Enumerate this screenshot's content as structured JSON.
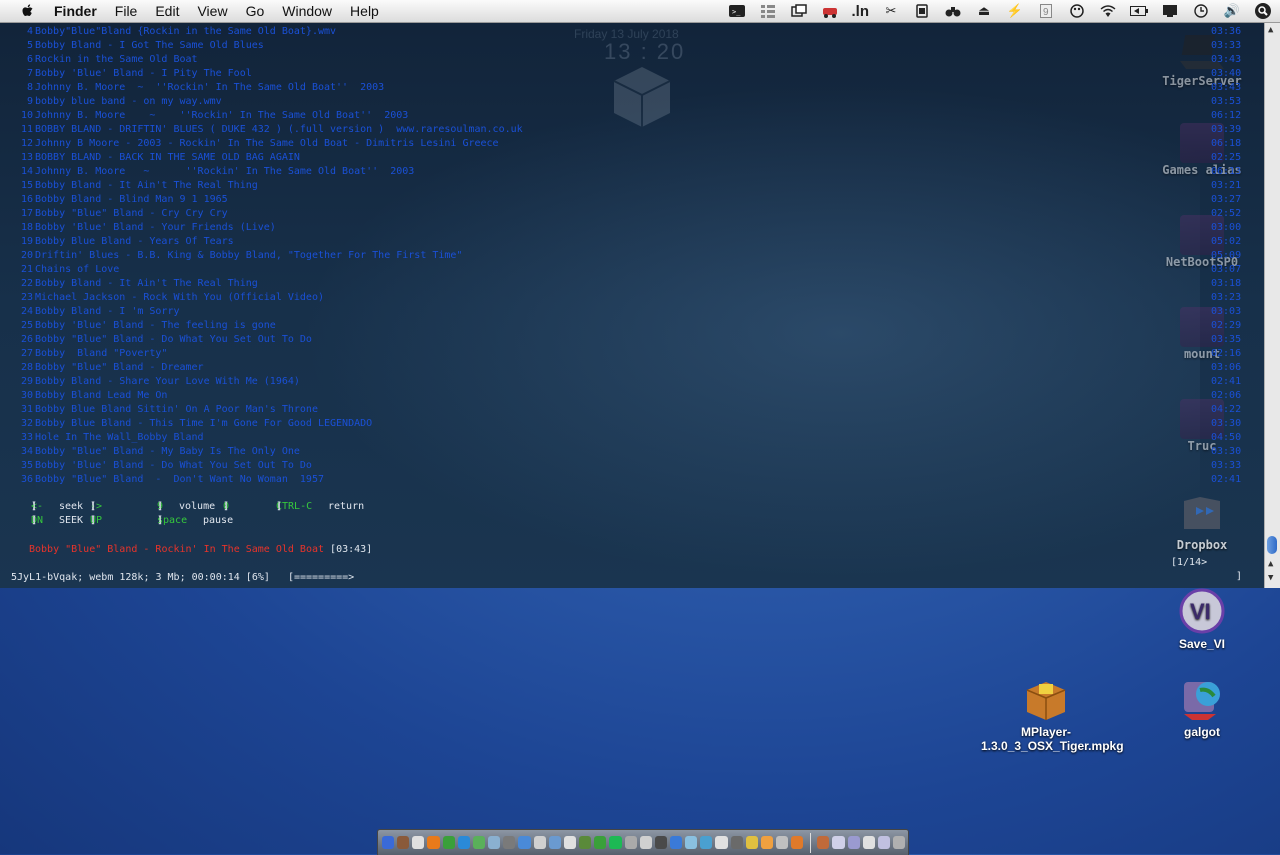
{
  "menubar": {
    "items": [
      "Finder",
      "File",
      "Edit",
      "View",
      "Go",
      "Window",
      "Help"
    ],
    "extra_text": ".ln"
  },
  "terminal": {
    "clock_date": "Friday 13 July 2018",
    "clock_time": "13 : 20",
    "playlist": [
      {
        "num": "4",
        "title": "Bobby\"Blue\"Bland {Rockin in the Same Old Boat}.wmv",
        "time": "03:36"
      },
      {
        "num": "5",
        "title": "Bobby Bland - I Got The Same Old Blues",
        "time": "03:33"
      },
      {
        "num": "6",
        "title": "Rockin in the Same Old Boat",
        "time": "03:43"
      },
      {
        "num": "7",
        "title": "Bobby 'Blue' Bland - I Pity The Fool",
        "time": "03:40"
      },
      {
        "num": "8",
        "title": "Johnny B. Moore  ~  ''Rockin' In The Same Old Boat''  2003",
        "time": "03:43"
      },
      {
        "num": "9",
        "title": "bobby blue band - on my way.wmv",
        "time": "03:53"
      },
      {
        "num": "10",
        "title": "Johnny B. Moore    ~    ''Rockin' In The Same Old Boat''  2003",
        "time": "06:12"
      },
      {
        "num": "11",
        "title": "BOBBY BLAND - DRIFTIN' BLUES ( DUKE 432 ) (.full version )  www.raresoulman.co.uk",
        "time": "03:39"
      },
      {
        "num": "12",
        "title": "Johnny B Moore - 2003 - Rockin' In The Same Old Boat - Dimitris Lesini Greece",
        "time": "06:18"
      },
      {
        "num": "13",
        "title": "BOBBY BLAND - BACK IN THE SAME OLD BAG AGAIN",
        "time": "02:25"
      },
      {
        "num": "14",
        "title": "Johnny B. Moore   ~      ''Rockin' In The Same Old Boat''  2003",
        "time": "06:13"
      },
      {
        "num": "15",
        "title": "Bobby Bland - It Ain't The Real Thing",
        "time": "03:21"
      },
      {
        "num": "16",
        "title": "Bobby Bland - Blind Man 9 1 1965",
        "time": "03:27"
      },
      {
        "num": "17",
        "title": "Bobby \"Blue\" Bland - Cry Cry Cry",
        "time": "02:52"
      },
      {
        "num": "18",
        "title": "Bobby 'Blue' Bland - Your Friends (Live)",
        "time": "03:00"
      },
      {
        "num": "19",
        "title": "Bobby Blue Bland - Years Of Tears",
        "time": "05:02"
      },
      {
        "num": "20",
        "title": "Driftin' Blues - B.B. King & Bobby Bland, \"Together For The First Time\"",
        "time": "05:09"
      },
      {
        "num": "21",
        "title": "Chains of Love",
        "time": "03:07"
      },
      {
        "num": "22",
        "title": "Bobby Bland - It Ain't The Real Thing",
        "time": "03:18"
      },
      {
        "num": "23",
        "title": "Michael Jackson - Rock With You (Official Video)",
        "time": "03:23"
      },
      {
        "num": "24",
        "title": "Bobby Bland - I 'm Sorry",
        "time": "03:03"
      },
      {
        "num": "25",
        "title": "Bobby 'Blue' Bland - The feeling is gone",
        "time": "02:29"
      },
      {
        "num": "26",
        "title": "Bobby \"Blue\" Bland - Do What You Set Out To Do",
        "time": "03:35"
      },
      {
        "num": "27",
        "title": "Bobby  Bland \"Poverty\"",
        "time": "02:16"
      },
      {
        "num": "28",
        "title": "Bobby \"Blue\" Bland - Dreamer",
        "time": "03:06"
      },
      {
        "num": "29",
        "title": "Bobby Bland - Share Your Love With Me (1964)",
        "time": "02:41"
      },
      {
        "num": "30",
        "title": "Bobby Bland Lead Me On",
        "time": "02:06"
      },
      {
        "num": "31",
        "title": "Bobby Blue Bland Sittin' On A Poor Man's Throne",
        "time": "04:22"
      },
      {
        "num": "32",
        "title": "Bobby Blue Bland - This Time I'm Gone For Good LEGENDADO",
        "time": "03:30"
      },
      {
        "num": "33",
        "title": "Hole In The Wall_Bobby Bland",
        "time": "04:50"
      },
      {
        "num": "34",
        "title": "Bobby \"Blue\" Bland - My Baby Is The Only One",
        "time": "03:30"
      },
      {
        "num": "35",
        "title": "Bobby 'Blue' Bland - Do What You Set Out To Do",
        "time": "03:33"
      },
      {
        "num": "36",
        "title": "Bobby \"Blue\" Bland  -  Don't Want No Woman  1957",
        "time": "02:41"
      }
    ],
    "controls": {
      "seek_back_key": "<-",
      "seek_fwd_key": "->",
      "seek_label": "seek",
      "vol_down_key": "9",
      "vol_up_key": "0",
      "volume_label": "volume",
      "return_key": "CTRL-C",
      "return_label": "return",
      "seek_big_back_key": "DN",
      "seek_big_fwd_key": "UP",
      "seek_big_label": "SEEK",
      "pause_key": "space",
      "pause_label": "pause"
    },
    "now_playing": {
      "title": "Bobby \"Blue\" Bland - Rockin' In The Same Old Boat",
      "duration": "[03:43]"
    },
    "status": "5JyL1-bVqak; webm 128k; 3 Mb; 00:00:14 [6%]   [=========>",
    "pager": "[1/14>",
    "pager_end": "]",
    "progress_fraction": 0.06
  },
  "desktop_icons": [
    {
      "label": "TigerServer"
    },
    {
      "label": "Games alias"
    },
    {
      "label": "NetBootSP0"
    },
    {
      "label": "mount"
    },
    {
      "label": "Truc"
    },
    {
      "label": "Dropbox"
    },
    {
      "label": "Save_VI"
    },
    {
      "label": "galgot"
    },
    {
      "label": "MPlayer-1.3.0_3_OSX_Tiger.mpkg"
    }
  ],
  "save_vi_glyph": "VI",
  "colors": {
    "playlist_text": "#1a50d6",
    "key_highlight": "#36c83c",
    "now_playing": "#e8332a",
    "terminal_bg": "#17304a",
    "desktop_bg": "#2a58a8"
  }
}
